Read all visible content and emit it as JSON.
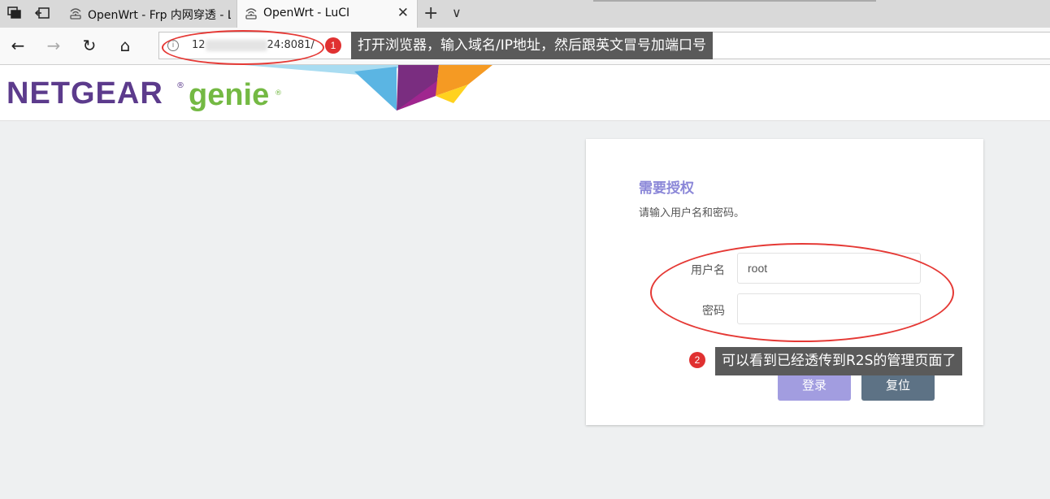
{
  "browser": {
    "tabs": [
      {
        "title": "OpenWrt - Frp 内网穿透 - L",
        "active": false
      },
      {
        "title": "OpenWrt - LuCI",
        "active": true
      }
    ],
    "new_tab_symbol": "+",
    "tab_menu_symbol": "∨",
    "close_symbol": "✕",
    "address": {
      "url_prefix": "12",
      "url_suffix": "24:8081/",
      "info_symbol": "i"
    },
    "nav_icons": {
      "back": "←",
      "forward": "→",
      "reload": "↻",
      "home": "⌂"
    }
  },
  "annotations": [
    {
      "number": "1",
      "text": "打开浏览器，输入域名/IP地址，然后跟英文冒号加端口号"
    },
    {
      "number": "2",
      "text": "可以看到已经透传到R2S的管理页面了"
    }
  ],
  "header": {
    "logo_brand": "NETGEAR",
    "logo_product": "genie",
    "registered_mark": "®"
  },
  "login": {
    "title": "需要授权",
    "description": "请输入用户名和密码。",
    "username_label": "用户名",
    "username_value": "root",
    "password_label": "密码",
    "password_value": "",
    "login_button": "登录",
    "reset_button": "复位"
  },
  "colors": {
    "accent": "#8b87d8",
    "login_button": "#a29de0",
    "reset_button": "#5d7285",
    "annotation_red": "#e53935",
    "netgear_purple": "#5c3b8c",
    "genie_green": "#74b943"
  },
  "icons": {
    "window_icon_1": "overlapping-windows-icon",
    "window_icon_2": "tab-aside-icon",
    "favicon": "wifi-router-icon"
  }
}
